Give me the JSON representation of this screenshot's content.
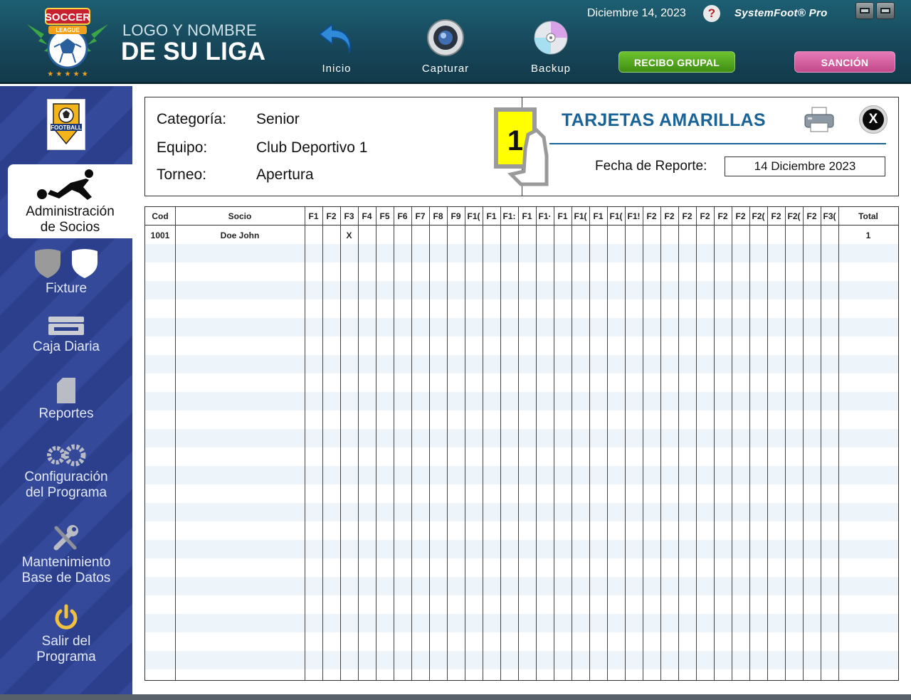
{
  "header": {
    "league_line1": "LOGO Y NOMBRE",
    "league_line2": "DE SU LIGA",
    "logo_top_text": "SOCCER",
    "logo_ribbon_text": "LEAGUE",
    "date": "Diciembre 14, 2023",
    "brand": "SystemFoot® Pro",
    "help_label": "?",
    "tools": [
      {
        "label": "Inicio",
        "icon": "undo-arrow-icon"
      },
      {
        "label": "Capturar",
        "icon": "camera-icon"
      },
      {
        "label": "Backup",
        "icon": "disc-icon"
      }
    ],
    "recibo_label": "RECIBO GRUPAL",
    "sancion_label": "SANCIÓN"
  },
  "sidebar": {
    "team_logo_text": "FOOTBALL",
    "items": [
      {
        "label_1": "Administración",
        "label_2": "de Socios"
      },
      {
        "label_1": "Fixture",
        "label_2": ""
      },
      {
        "label_1": "Caja Diaria",
        "label_2": ""
      },
      {
        "label_1": "Reportes",
        "label_2": ""
      },
      {
        "label_1": "Configuración",
        "label_2": "del Programa"
      },
      {
        "label_1": "Mantenimiento",
        "label_2": "Base de Datos"
      },
      {
        "label_1": "Salir del",
        "label_2": "Programa"
      }
    ]
  },
  "report": {
    "categoria_label": "Categoría:",
    "categoria_value": "Senior",
    "equipo_label": "Equipo:",
    "equipo_value": "Club Deportivo 1",
    "torneo_label": "Torneo:",
    "torneo_value": "Apertura",
    "card_number": "1",
    "title": "TARJETAS AMARILLAS",
    "fecha_label": "Fecha de Reporte:",
    "fecha_value": "14 Diciembre 2023",
    "close_label": "X",
    "card_color": "#ffff00",
    "title_color": "#1a6396"
  },
  "table": {
    "headers": [
      "Cod",
      "Socio",
      "F1",
      "F2",
      "F3",
      "F4",
      "F5",
      "F6",
      "F7",
      "F8",
      "F9",
      "F1(",
      "F1",
      "F1:",
      "F1",
      "F1·",
      "F1",
      "F1(",
      "F1",
      "F1(",
      "F1!",
      "F2",
      "F2",
      "F2",
      "F2",
      "F2",
      "F2",
      "F2(",
      "F2",
      "F2(",
      "F2",
      "F3(",
      "Total"
    ],
    "rows": [
      {
        "cod": "1001",
        "socio": "Doe John",
        "marks": [
          "",
          "",
          "X",
          "",
          "",
          "",
          "",
          "",
          "",
          "",
          "",
          "",
          "",
          "",
          "",
          "",
          "",
          "",
          "",
          "",
          "",
          "",
          "",
          "",
          "",
          "",
          "",
          "",
          "",
          ""
        ],
        "total": "1"
      }
    ]
  }
}
